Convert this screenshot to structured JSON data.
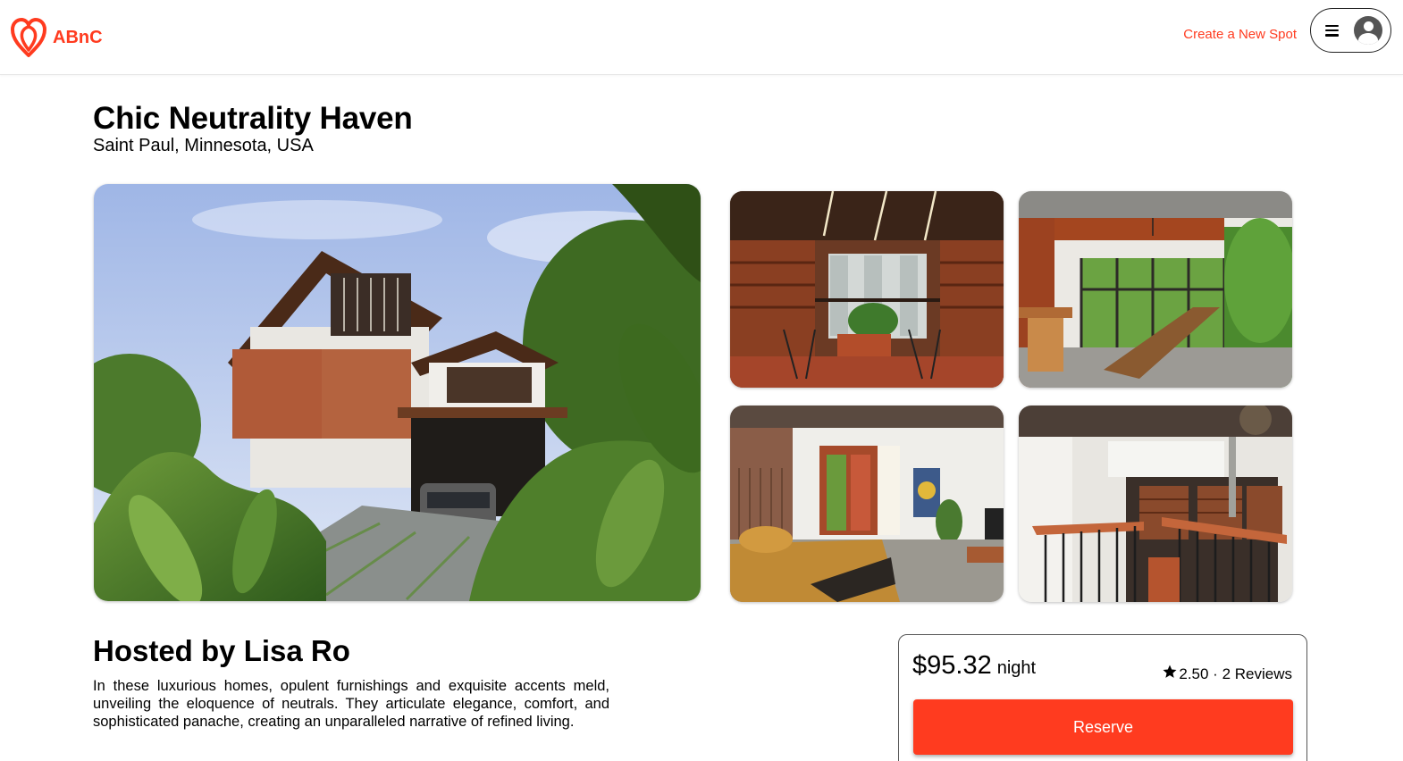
{
  "brand": {
    "name": "ABnC",
    "color": "#ff3b1f",
    "logo_icon": "heart-logo-icon"
  },
  "header": {
    "create_spot": "Create a New Spot",
    "menu_icon": "hamburger-menu-icon",
    "avatar_icon": "user-avatar-icon"
  },
  "spot": {
    "name": "Chic Neutrality Haven",
    "location": "Saint Paul, Minnesota, USA",
    "images": [
      {
        "alt": "House exterior with garden and driveway"
      },
      {
        "alt": "Covered balcony with wooden louvers and seating"
      },
      {
        "alt": "Dining area with long wooden table"
      },
      {
        "alt": "Bedroom with mustard bedding"
      },
      {
        "alt": "Staircase and upper landing with railings"
      }
    ]
  },
  "host": {
    "heading": "Hosted by Lisa Ro",
    "description": "In these luxurious homes, opulent furnishings and exquisite accents meld, unveiling the eloquence of neutrals. They articulate elegance, comfort, and sophisticated panache, creating an unparalleled narrative of refined living."
  },
  "booking": {
    "price": "$95.32",
    "unit": "night",
    "rating_text": "2.50 · 2 Reviews",
    "star_icon": "star-icon",
    "reserve_label": "Reserve"
  }
}
